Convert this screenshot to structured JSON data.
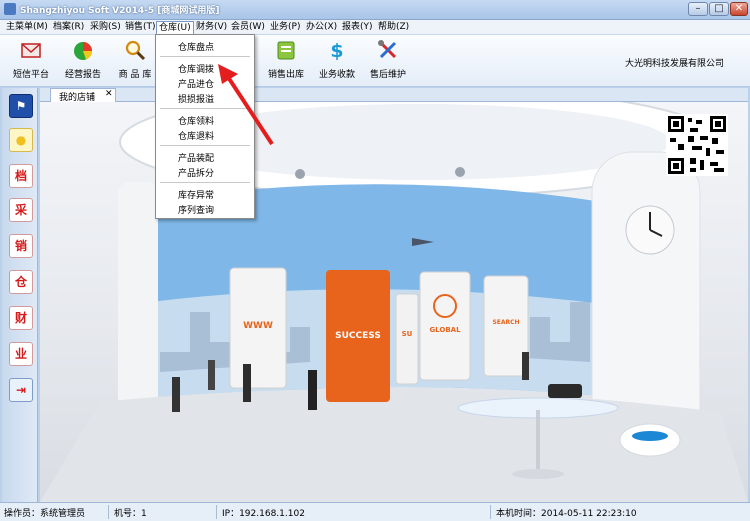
{
  "window": {
    "title": "Shangzhiyou Soft V2014-5 [商城网试用版]",
    "min_glyph": "–",
    "max_glyph": "□",
    "close_glyph": "✕"
  },
  "menubar": {
    "items": [
      "主菜单(M)",
      "档案(R)",
      "采购(S)",
      "销售(T)",
      "仓库(U)",
      "财务(V)",
      "会员(W)",
      "业务(P)",
      "办公(X)",
      "报表(Y)",
      "帮助(Z)"
    ]
  },
  "toolbar": {
    "buttons": [
      {
        "label": "短信平台",
        "icon": "envelope-icon"
      },
      {
        "label": "经营报告",
        "icon": "pie-chart-icon"
      },
      {
        "label": "商 品 库",
        "icon": "magnifier-icon"
      },
      {
        "label": "销售出库",
        "icon": "inventory-icon"
      },
      {
        "label": "业务收款",
        "icon": "dollar-icon"
      },
      {
        "label": "售后维护",
        "icon": "tools-icon"
      }
    ],
    "company": "大光明科技发展有限公司"
  },
  "sidebar": {
    "buttons": [
      {
        "glyph": "⚑",
        "icon": "flag-icon"
      },
      {
        "glyph": "●",
        "icon": "lightbulb-icon"
      },
      {
        "glyph": "档",
        "icon": "archive-char-icon"
      },
      {
        "glyph": "采",
        "icon": "purchase-char-icon"
      },
      {
        "glyph": "销",
        "icon": "sales-char-icon"
      },
      {
        "glyph": "仓",
        "icon": "warehouse-char-icon"
      },
      {
        "glyph": "财",
        "icon": "finance-char-icon"
      },
      {
        "glyph": "业",
        "icon": "business-char-icon"
      },
      {
        "glyph": "⇥",
        "icon": "exit-icon"
      }
    ]
  },
  "tabs": [
    {
      "label": "我的店铺",
      "close": "✕"
    }
  ],
  "warehouse_menu": {
    "groups": [
      [
        "仓库盘点"
      ],
      [
        "仓库调拨",
        "产品进仓",
        "损损报溢"
      ],
      [
        "仓库领料",
        "仓库退料"
      ],
      [
        "产品装配",
        "产品拆分"
      ],
      [
        "库存异常",
        "序列查询"
      ]
    ]
  },
  "scene": {
    "panels": [
      "WWW",
      "SUCCESS",
      "SU",
      "GLOBAL",
      "SEARCH"
    ]
  },
  "colors": {
    "accent_red": "#d31b1b",
    "success_orange": "#e8641c",
    "window_blue": "#b9d1ea"
  },
  "statusbar": {
    "operator": "操作员：系统管理员",
    "machine": "机号：1",
    "ip": "IP：192.168.1.102",
    "time": "本机时间：2014-05-11 22:23:10"
  }
}
